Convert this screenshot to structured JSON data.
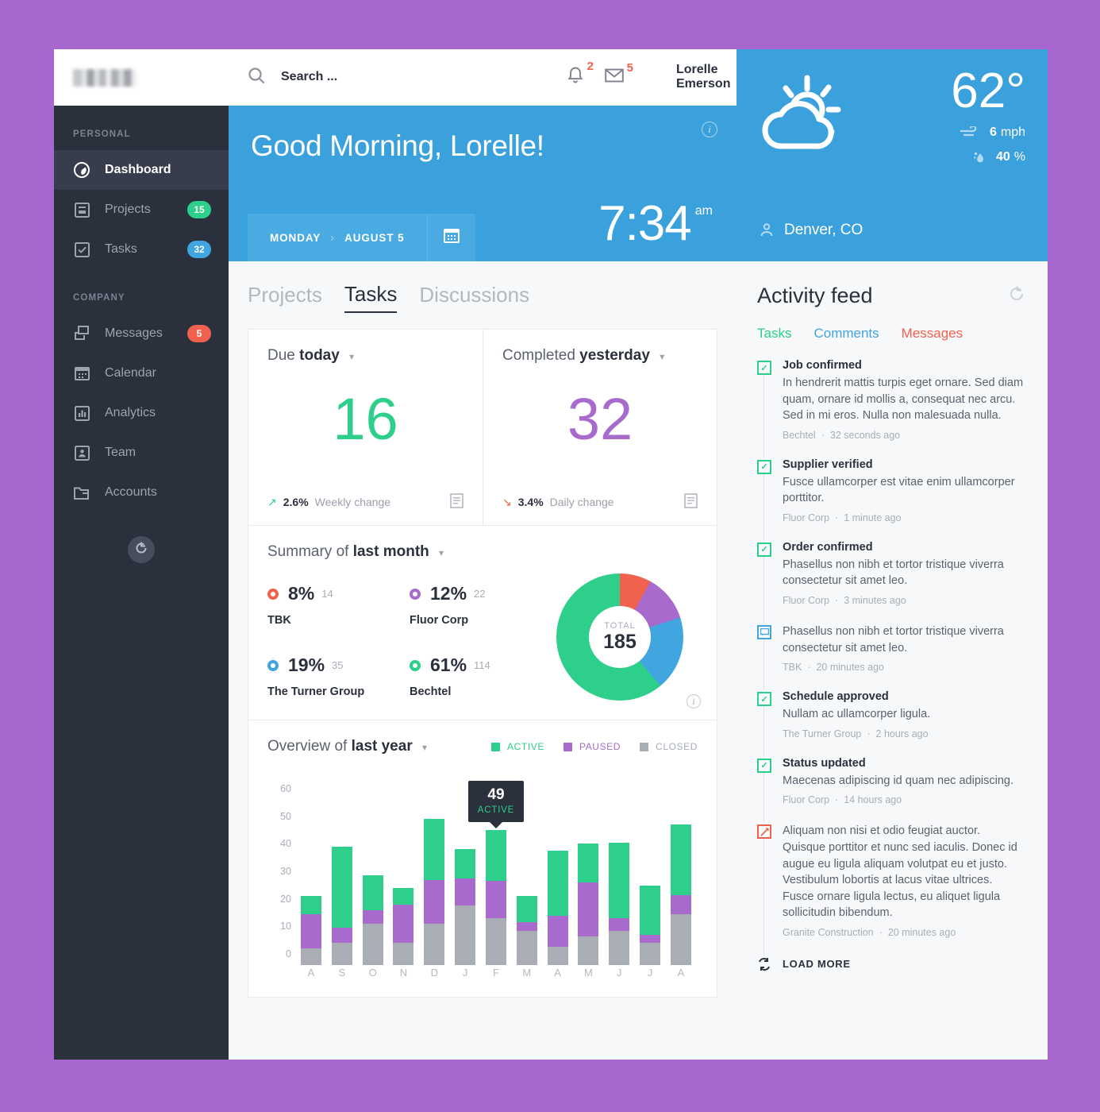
{
  "sidebar": {
    "logo_alt": "company-logo",
    "sections": [
      {
        "label": "PERSONAL",
        "items": [
          {
            "label": "Dashboard",
            "icon": "dashboard-icon",
            "badge": null,
            "active": true
          },
          {
            "label": "Projects",
            "icon": "projects-icon",
            "badge": "15",
            "badge_color": "green"
          },
          {
            "label": "Tasks",
            "icon": "tasks-icon",
            "badge": "32",
            "badge_color": "blue"
          }
        ]
      },
      {
        "label": "COMPANY",
        "items": [
          {
            "label": "Messages",
            "icon": "messages-icon",
            "badge": "5",
            "badge_color": "red"
          },
          {
            "label": "Calendar",
            "icon": "calendar-icon",
            "badge": null
          },
          {
            "label": "Analytics",
            "icon": "analytics-icon",
            "badge": null
          },
          {
            "label": "Team",
            "icon": "team-icon",
            "badge": null
          },
          {
            "label": "Accounts",
            "icon": "accounts-icon",
            "badge": null
          }
        ]
      }
    ],
    "refresh_icon": "refresh-icon"
  },
  "topbar": {
    "search_placeholder": "Search ...",
    "search_value": "",
    "notifications_count": "2",
    "messages_count": "5",
    "user_name": "Lorelle Emerson"
  },
  "greeting": {
    "title": "Good Morning, Lorelle!",
    "day": "MONDAY",
    "separator": "›",
    "date": "AUGUST 5",
    "time": "7:34",
    "ampm": "am"
  },
  "weather": {
    "temperature": "62°",
    "wind_value": "6",
    "wind_unit": "mph",
    "humidity_value": "40",
    "humidity_unit": "%",
    "location": "Denver, CO"
  },
  "main_tabs": [
    {
      "label": "Projects",
      "active": false
    },
    {
      "label": "Tasks",
      "active": true
    },
    {
      "label": "Discussions",
      "active": false
    }
  ],
  "stats": [
    {
      "title_light": "Due",
      "title_bold": "today",
      "value": "16",
      "color": "green",
      "change_dir": "up",
      "change_pct": "2.6%",
      "change_label": "Weekly change"
    },
    {
      "title_light": "Completed",
      "title_bold": "yesterday",
      "value": "32",
      "color": "purple",
      "change_dir": "down",
      "change_pct": "3.4%",
      "change_label": "Daily change"
    }
  ],
  "summary": {
    "title_light": "Summary of",
    "title_bold": "last month",
    "total_label": "TOTAL",
    "total_value": "185",
    "items": [
      {
        "pct": "8%",
        "count": "14",
        "name": "TBK",
        "color": "#f0624d"
      },
      {
        "pct": "12%",
        "count": "22",
        "name": "Fluor Corp",
        "color": "#a86bcd"
      },
      {
        "pct": "19%",
        "count": "35",
        "name": "The Turner Group",
        "color": "#41a5e0"
      },
      {
        "pct": "61%",
        "count": "114",
        "name": "Bechtel",
        "color": "#2ece8b"
      }
    ]
  },
  "overview": {
    "title_light": "Overview of",
    "title_bold": "last year",
    "tooltip_value": "49",
    "tooltip_series": "ACTIVE",
    "tooltip_index": 6
  },
  "chart_data": {
    "type": "bar",
    "stacked": true,
    "title": "Overview of last year",
    "categories": [
      "A",
      "S",
      "O",
      "N",
      "D",
      "J",
      "F",
      "M",
      "A",
      "M",
      "J",
      "J",
      "A"
    ],
    "series": [
      {
        "name": "CLOSED",
        "color": "#a8adb6",
        "values": [
          6,
          8,
          15,
          8,
          15,
          21.5,
          17,
          12.5,
          6.5,
          10.5,
          12.5,
          8,
          18.5
        ]
      },
      {
        "name": "PAUSED",
        "color": "#a86bcd",
        "values": [
          12.5,
          5.5,
          5,
          14,
          16,
          10,
          13.5,
          3,
          11.5,
          19.5,
          4.5,
          3,
          7
        ]
      },
      {
        "name": "ACTIVE",
        "color": "#2ece8b",
        "values": [
          6.5,
          29.5,
          12.5,
          6,
          22,
          10.5,
          18.5,
          9.5,
          23.5,
          14,
          27.5,
          18,
          25.5
        ]
      }
    ],
    "totals": [
      25,
      43,
      32.5,
      28,
      53,
      42,
      49,
      25,
      41.5,
      44,
      44.5,
      29,
      51
    ],
    "yticks": [
      0,
      10,
      20,
      30,
      40,
      50,
      60
    ],
    "ylim": [
      0,
      60
    ],
    "xlabel": "",
    "ylabel": "",
    "grid": false,
    "legend_position": "top-right",
    "legend": [
      {
        "label": "ACTIVE",
        "color": "#2ece8b"
      },
      {
        "label": "PAUSED",
        "color": "#a86bcd"
      },
      {
        "label": "CLOSED",
        "color": "#a8adb6"
      }
    ]
  },
  "activity": {
    "title": "Activity feed",
    "tabs": [
      {
        "label": "Tasks",
        "color": "#2ece8b"
      },
      {
        "label": "Comments",
        "color": "#41a5e0"
      },
      {
        "label": "Messages",
        "color": "#f0624d"
      }
    ],
    "items": [
      {
        "icon": "check-icon",
        "icon_color": "green",
        "title": "Job confirmed",
        "desc": "In hendrerit mattis turpis eget ornare. Sed diam quam, ornare id mollis a, consequat nec arcu. Sed in mi eros. Nulla non malesuada nulla.",
        "source": "Bechtel",
        "time": "32 seconds ago"
      },
      {
        "icon": "check-icon",
        "icon_color": "green",
        "title": "Supplier verified",
        "desc": "Fusce ullamcorper est vitae enim ullamcorper porttitor.",
        "source": "Fluor Corp",
        "time": "1 minute ago"
      },
      {
        "icon": "check-icon",
        "icon_color": "green",
        "title": "Order confirmed",
        "desc": "Phasellus non nibh et tortor tristique viverra consectetur sit amet leo.",
        "source": "Fluor Corp",
        "time": "3 minutes ago"
      },
      {
        "icon": "comment-icon",
        "icon_color": "blue",
        "title": "",
        "desc": "Phasellus non nibh et tortor tristique viverra consectetur sit amet leo.",
        "source": "TBK",
        "time": "20 minutes ago"
      },
      {
        "icon": "check-icon",
        "icon_color": "green",
        "title": "Schedule approved",
        "desc": "Nullam ac ullamcorper ligula.",
        "source": "The Turner Group",
        "time": "2 hours ago"
      },
      {
        "icon": "check-icon",
        "icon_color": "green",
        "title": "Status updated",
        "desc": "Maecenas adipiscing id quam nec adipiscing.",
        "source": "Fluor Corp",
        "time": "14 hours ago"
      },
      {
        "icon": "edit-icon",
        "icon_color": "red",
        "title": "",
        "desc": "Aliquam non nisi et odio feugiat auctor. Quisque porttitor et nunc sed iaculis. Donec id augue eu ligula aliquam volutpat eu et justo. Vestibulum lobortis at lacus vitae ultrices. Fusce ornare ligula lectus, eu aliquet ligula sollicitudin bibendum.",
        "source": "Granite Construction",
        "time": "20 minutes ago"
      }
    ],
    "load_more": "LOAD MORE"
  },
  "colors": {
    "accent_blue": "#3ba1dd",
    "green": "#2ece8b",
    "purple": "#a86bcd",
    "red": "#f0624d",
    "grey": "#a8adb6",
    "dark": "#2b303d",
    "page_bg": "#a866cf"
  }
}
